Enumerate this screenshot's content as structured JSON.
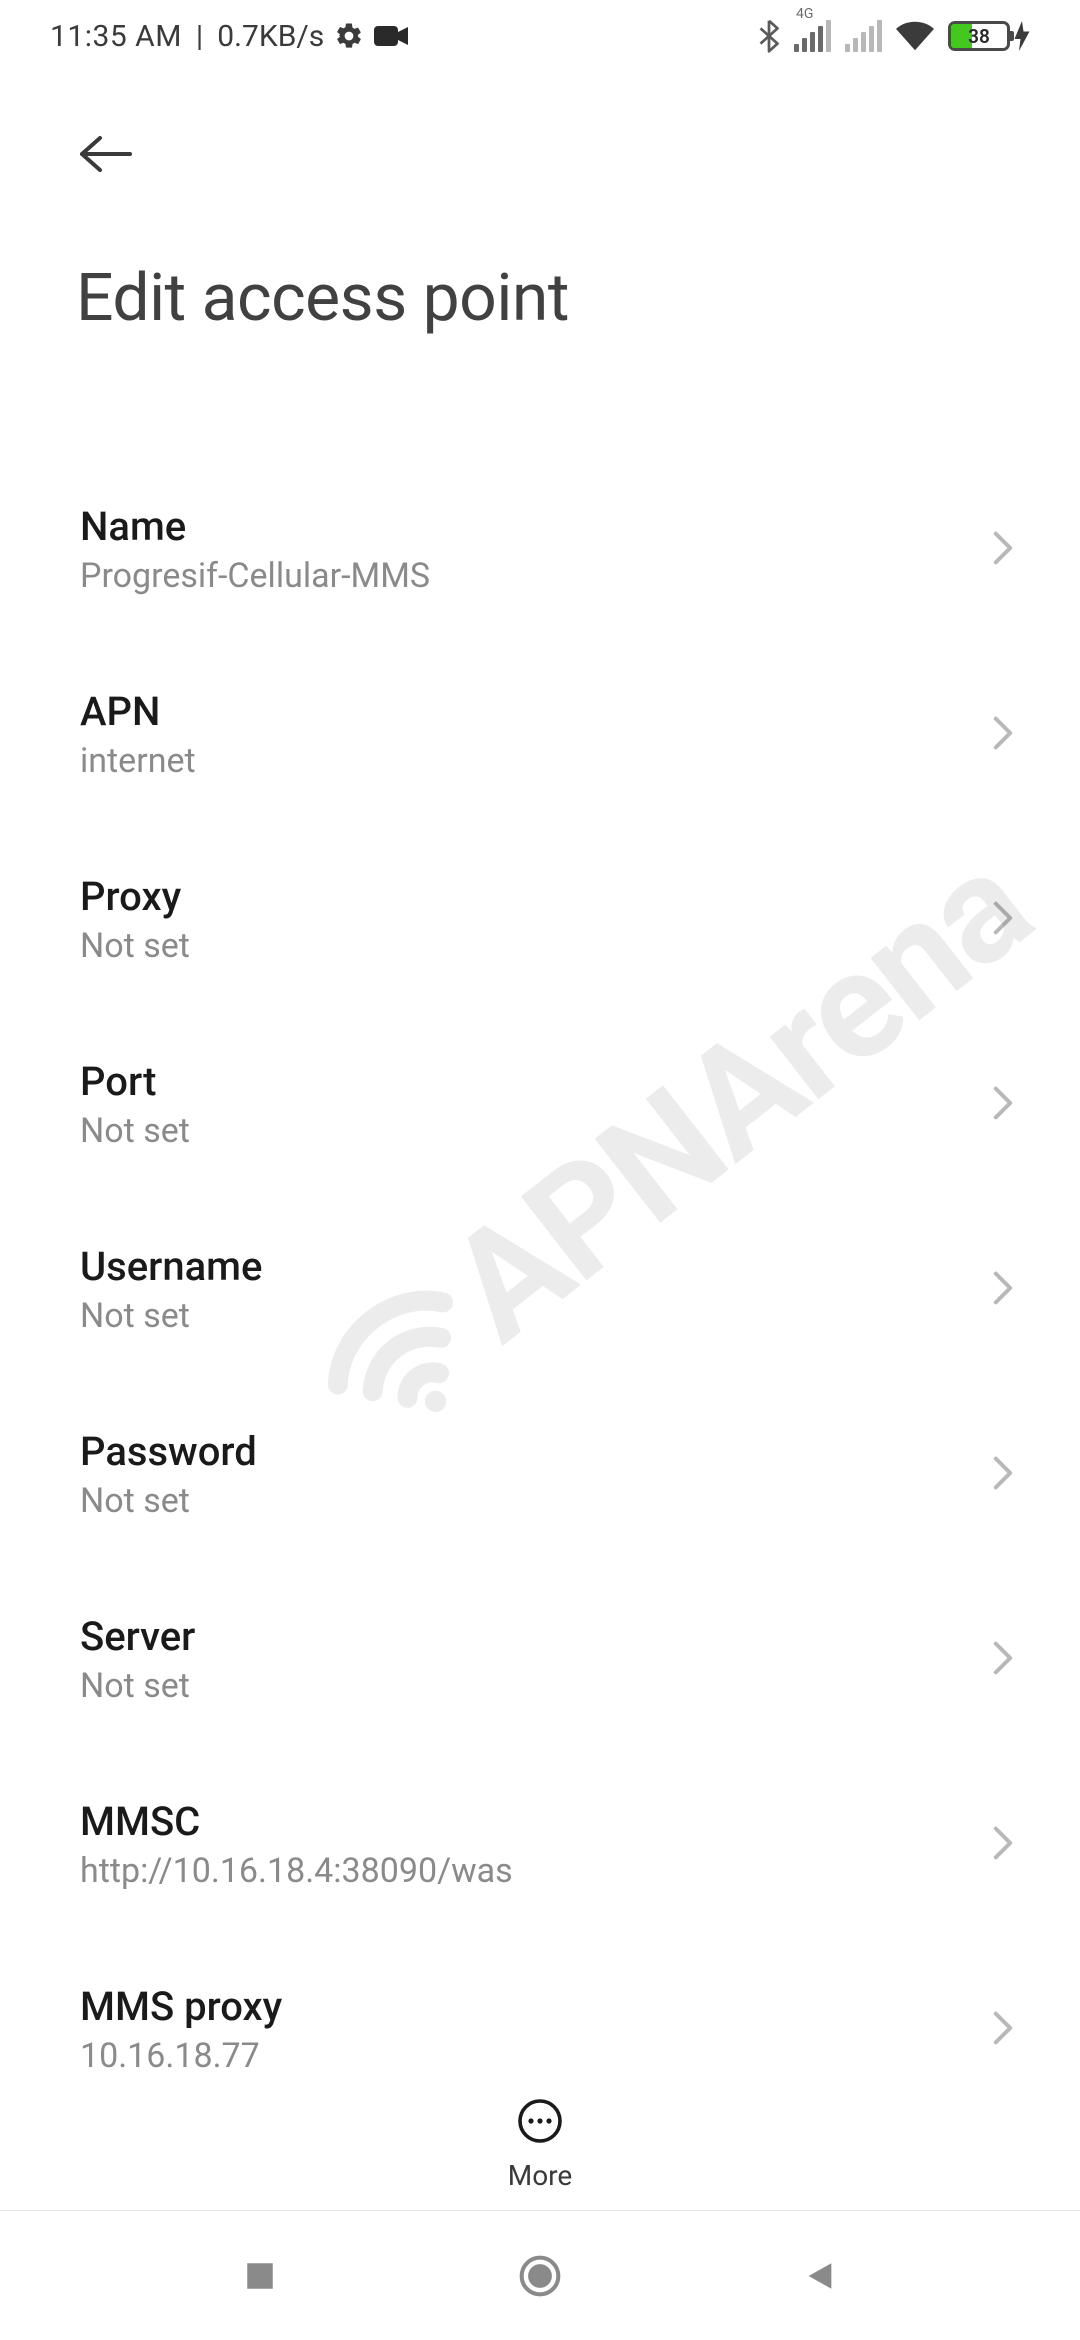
{
  "status": {
    "time": "11:35 AM",
    "net_speed": "0.7KB/s",
    "sig1_label": "4G",
    "battery_pct": "38"
  },
  "header": {
    "title": "Edit access point"
  },
  "rows": [
    {
      "title": "Name",
      "value": "Progresif-Cellular-MMS"
    },
    {
      "title": "APN",
      "value": "internet"
    },
    {
      "title": "Proxy",
      "value": "Not set"
    },
    {
      "title": "Port",
      "value": "Not set"
    },
    {
      "title": "Username",
      "value": "Not set"
    },
    {
      "title": "Password",
      "value": "Not set"
    },
    {
      "title": "Server",
      "value": "Not set"
    },
    {
      "title": "MMSC",
      "value": "http://10.16.18.4:38090/was"
    },
    {
      "title": "MMS proxy",
      "value": "10.16.18.77"
    }
  ],
  "actions": {
    "more": "More"
  },
  "watermark": "APNArena"
}
